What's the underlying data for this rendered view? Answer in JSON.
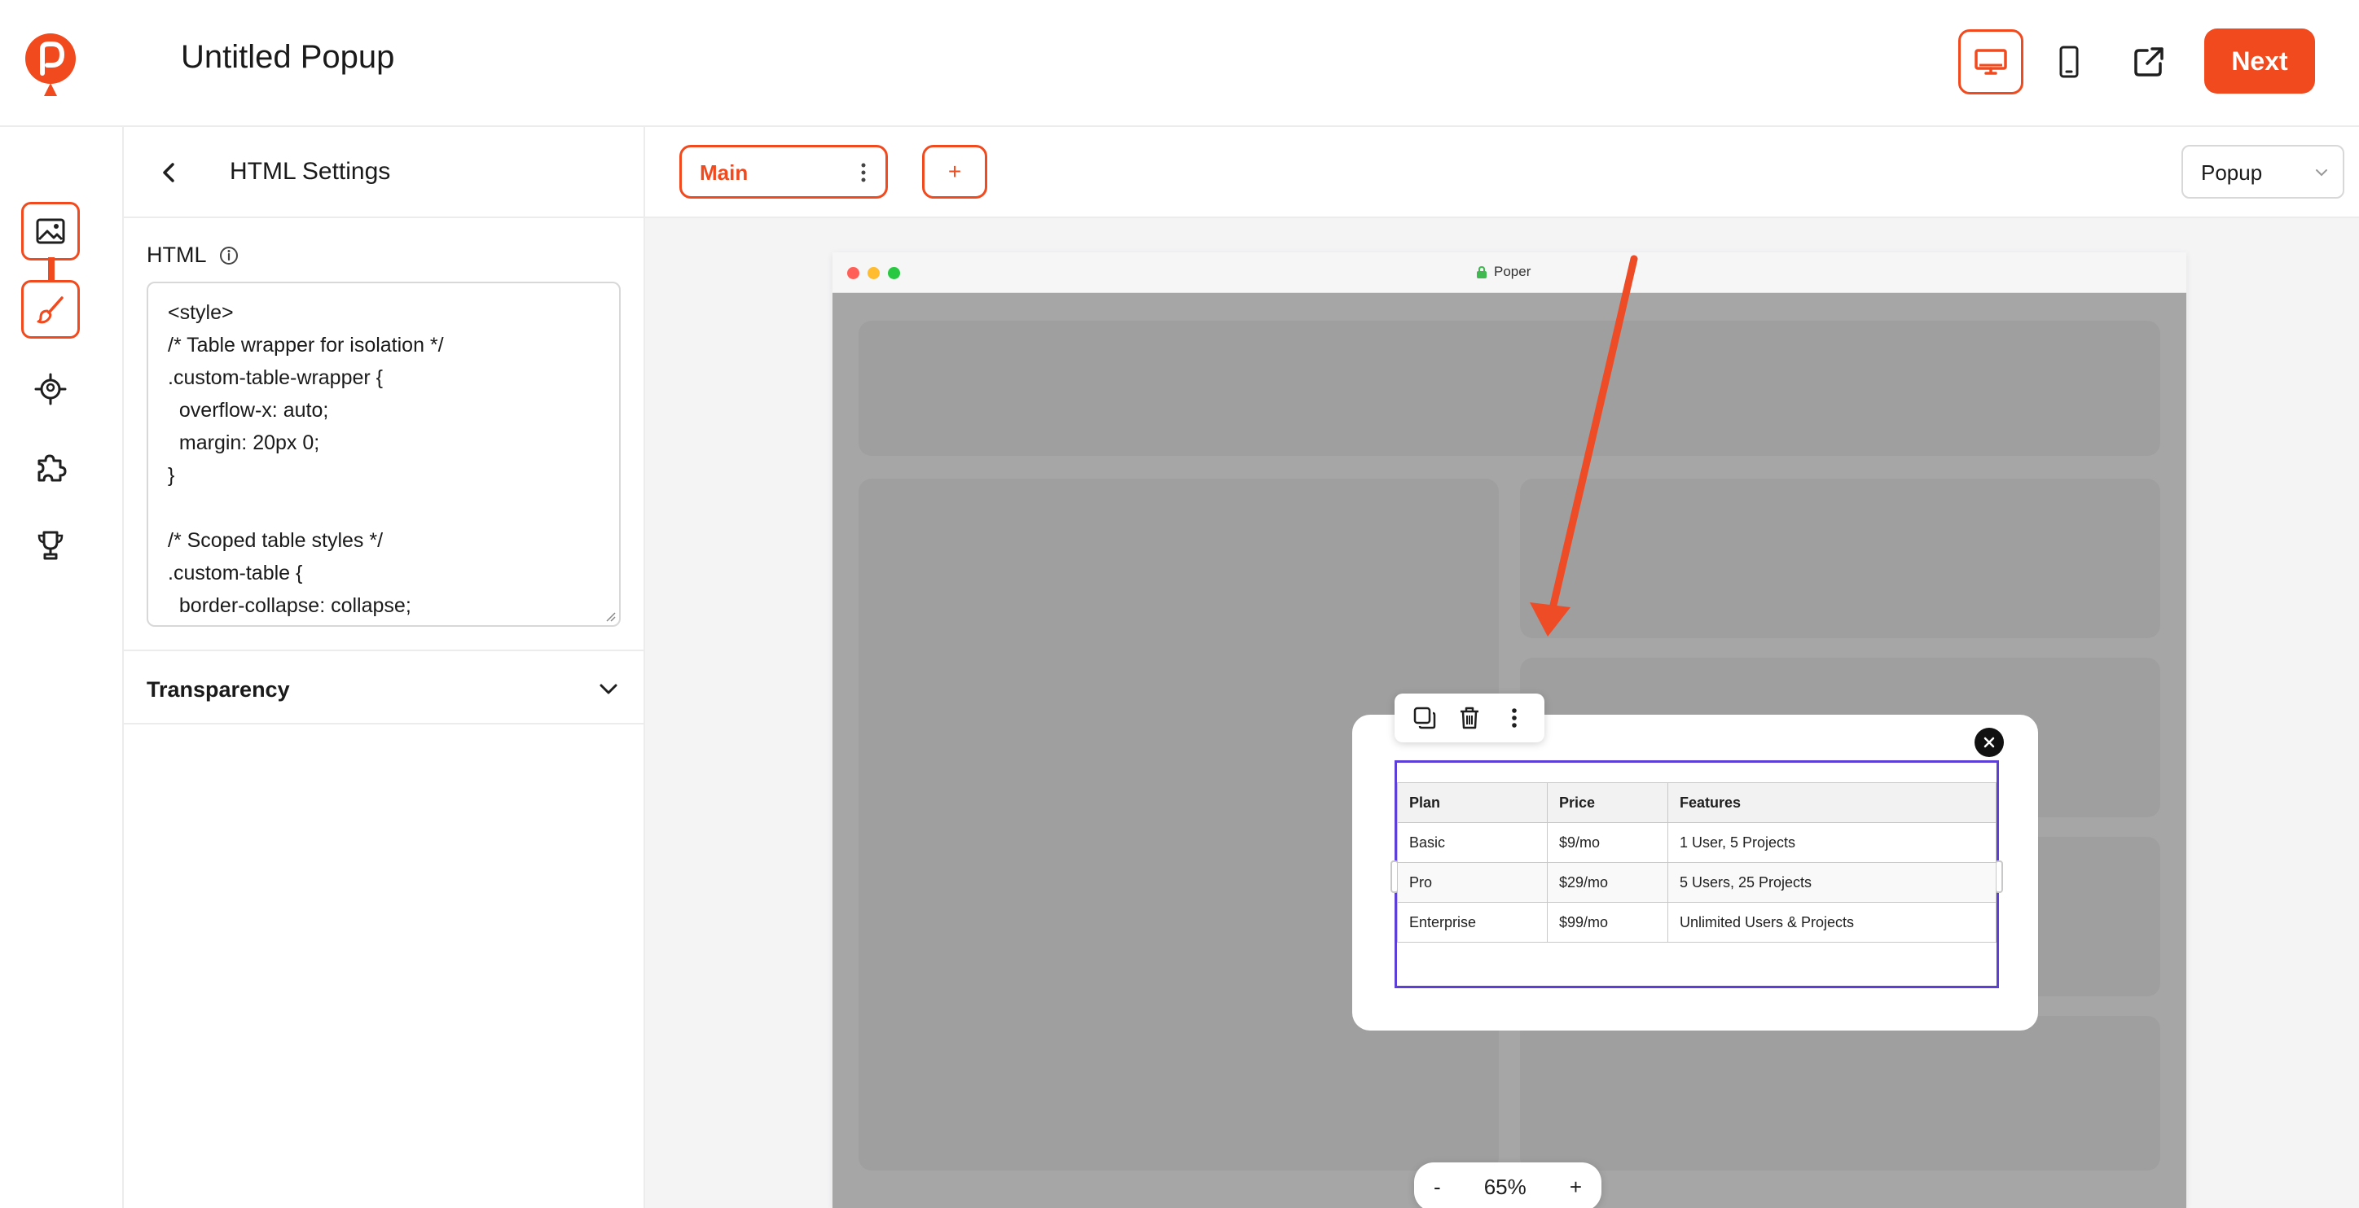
{
  "header": {
    "title": "Untitled Popup",
    "next_label": "Next",
    "buttons": [
      "desktop-icon",
      "mobile-icon",
      "external-link-icon"
    ]
  },
  "brand": {
    "accent": "#f14a1e",
    "selection": "#5b3fd6"
  },
  "rail": {
    "items": [
      "image-icon",
      "brush-icon",
      "target-icon",
      "puzzle-icon",
      "trophy-icon"
    ],
    "active": "brush-icon"
  },
  "panel": {
    "title": "HTML Settings",
    "html_label": "HTML",
    "code": "<style>\n/* Table wrapper for isolation */\n.custom-table-wrapper {\n  overflow-x: auto;\n  margin: 20px 0;\n}\n\n/* Scoped table styles */\n.custom-table {\n  border-collapse: collapse;",
    "sections": [
      {
        "title": "Transparency"
      }
    ]
  },
  "canvas": {
    "tab_main": "Main",
    "tab_add": "+",
    "type_select": "Popup",
    "browser_title": "Poper",
    "zoom": {
      "minus": "-",
      "value": "65%",
      "plus": "+"
    }
  },
  "table": {
    "headers": [
      "Plan",
      "Price",
      "Features"
    ],
    "rows": [
      [
        "Basic",
        "$9/mo",
        "1 User, 5 Projects"
      ],
      [
        "Pro",
        "$29/mo",
        "5 Users, 25 Projects"
      ],
      [
        "Enterprise",
        "$99/mo",
        "Unlimited Users & Projects"
      ]
    ]
  }
}
